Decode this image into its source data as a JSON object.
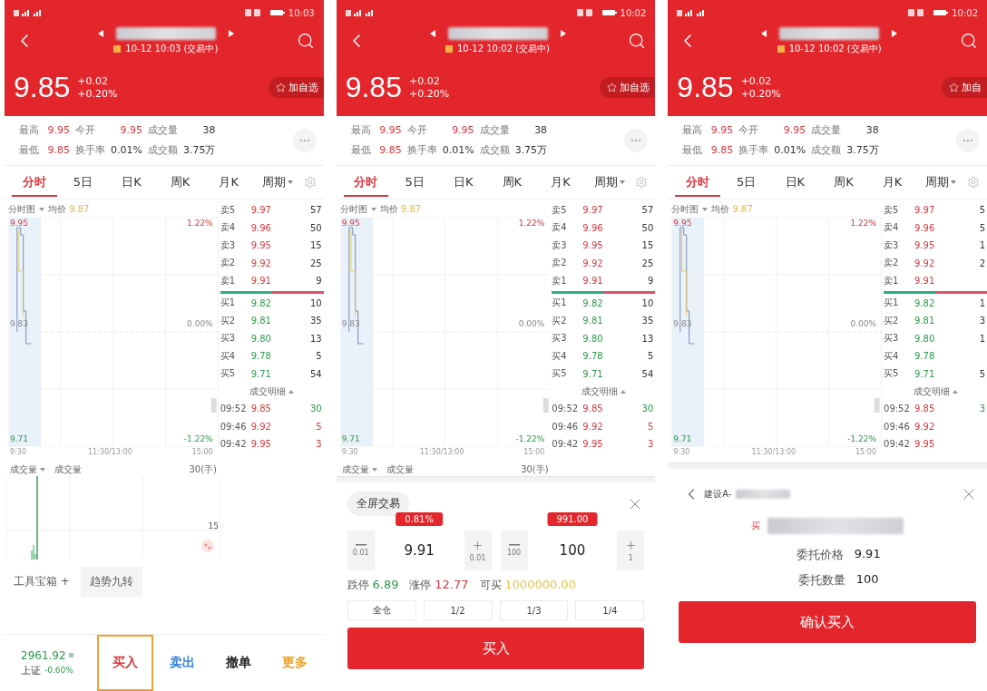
{
  "screens": [
    {
      "status_time": "10:03",
      "date_line": "10-12 10:03 (交易中)",
      "price": "9.85",
      "change": "+0.02",
      "change_pct": "+0.20%",
      "watch_label": "加自选",
      "stats": [
        {
          "label": "最高",
          "value": "9.95",
          "kind": "price"
        },
        {
          "label": "今开",
          "value": "9.95",
          "kind": "price"
        },
        {
          "label": "成交量",
          "value": "38",
          "kind": "plain"
        },
        {
          "label": "最低",
          "value": "9.85",
          "kind": "price"
        },
        {
          "label": "换手率",
          "value": "0.01%",
          "kind": "plain"
        },
        {
          "label": "成交额",
          "value": "3.75万",
          "kind": "plain"
        }
      ],
      "tabs": [
        {
          "label": "分时",
          "selected": true,
          "dropdown": false
        },
        {
          "label": "5日",
          "selected": false,
          "dropdown": false
        },
        {
          "label": "日K",
          "selected": false,
          "dropdown": false
        },
        {
          "label": "周K",
          "selected": false,
          "dropdown": false
        },
        {
          "label": "月K",
          "selected": false,
          "dropdown": false
        },
        {
          "label": "周期",
          "selected": false,
          "dropdown": true
        }
      ],
      "chart": {
        "title": "分时图",
        "avg_label": "均价",
        "avg_value": "9.87",
        "high": "9.95",
        "mid": "9.83",
        "low": "9.71",
        "high_pct": "1.22%",
        "mid_pct": "0.00%",
        "low_pct": "-1.22%",
        "t_start": "9:30",
        "t_mid": "11:30/13:00",
        "t_end": "15:00"
      },
      "asks": [
        {
          "label": "卖5",
          "price": "9.97",
          "qty": "57"
        },
        {
          "label": "卖4",
          "price": "9.96",
          "qty": "50"
        },
        {
          "label": "卖3",
          "price": "9.95",
          "qty": "15"
        },
        {
          "label": "卖2",
          "price": "9.92",
          "qty": "25"
        },
        {
          "label": "卖1",
          "price": "9.91",
          "qty": "9"
        }
      ],
      "bids": [
        {
          "label": "买1",
          "price": "9.82",
          "qty": "10"
        },
        {
          "label": "买2",
          "price": "9.81",
          "qty": "35"
        },
        {
          "label": "买3",
          "price": "9.80",
          "qty": "13"
        },
        {
          "label": "买4",
          "price": "9.78",
          "qty": "5"
        },
        {
          "label": "买5",
          "price": "9.71",
          "qty": "54"
        }
      ],
      "trades_title": "成交明细",
      "trades": [
        {
          "time": "09:52",
          "price": "9.85",
          "qty": "30",
          "color": "#2b9a4b"
        },
        {
          "time": "09:46",
          "price": "9.92",
          "qty": "5",
          "color": "#d9363e"
        },
        {
          "time": "09:42",
          "price": "9.95",
          "qty": "3",
          "color": "#d9363e"
        }
      ],
      "volume": {
        "title": "成交量",
        "label": "成交量",
        "max": "30(手)",
        "mid": "15"
      },
      "panel": {
        "kind": "toolbar",
        "tools_label": "工具宝箱 +",
        "tool_chip": "趋势九转",
        "index_value": "2961.92",
        "index_name": "上证",
        "index_change": "-0.60%",
        "actions": [
          {
            "label": "买入",
            "selected": true,
            "kind": "buy"
          },
          {
            "label": "卖出",
            "selected": false,
            "kind": "sell"
          },
          {
            "label": "撤单",
            "selected": false,
            "kind": "cancel"
          },
          {
            "label": "更多",
            "selected": false,
            "kind": "more"
          }
        ]
      }
    },
    {
      "status_time": "10:02",
      "date_line": "10-12 10:02 (交易中)",
      "price": "9.85",
      "change": "+0.02",
      "change_pct": "+0.20%",
      "watch_label": "加自选",
      "stats": [
        {
          "label": "最高",
          "value": "9.95",
          "kind": "price"
        },
        {
          "label": "今开",
          "value": "9.95",
          "kind": "price"
        },
        {
          "label": "成交量",
          "value": "38",
          "kind": "plain"
        },
        {
          "label": "最低",
          "value": "9.85",
          "kind": "price"
        },
        {
          "label": "换手率",
          "value": "0.01%",
          "kind": "plain"
        },
        {
          "label": "成交额",
          "value": "3.75万",
          "kind": "plain"
        }
      ],
      "tabs": [
        {
          "label": "分时",
          "selected": true,
          "dropdown": false
        },
        {
          "label": "5日",
          "selected": false,
          "dropdown": false
        },
        {
          "label": "日K",
          "selected": false,
          "dropdown": false
        },
        {
          "label": "周K",
          "selected": false,
          "dropdown": false
        },
        {
          "label": "月K",
          "selected": false,
          "dropdown": false
        },
        {
          "label": "周期",
          "selected": false,
          "dropdown": true
        }
      ],
      "chart": {
        "title": "分时图",
        "avg_label": "均价",
        "avg_value": "9.87",
        "high": "9.95",
        "mid": "9.83",
        "low": "9.71",
        "high_pct": "1.22%",
        "mid_pct": "0.00%",
        "low_pct": "-1.22%",
        "t_start": "9:30",
        "t_mid": "11:30/13:00",
        "t_end": "15:00"
      },
      "asks": [
        {
          "label": "卖5",
          "price": "9.97",
          "qty": "57"
        },
        {
          "label": "卖4",
          "price": "9.96",
          "qty": "50"
        },
        {
          "label": "卖3",
          "price": "9.95",
          "qty": "15"
        },
        {
          "label": "卖2",
          "price": "9.92",
          "qty": "25"
        },
        {
          "label": "卖1",
          "price": "9.91",
          "qty": "9"
        }
      ],
      "bids": [
        {
          "label": "买1",
          "price": "9.82",
          "qty": "10"
        },
        {
          "label": "买2",
          "price": "9.81",
          "qty": "35"
        },
        {
          "label": "买3",
          "price": "9.80",
          "qty": "13"
        },
        {
          "label": "买4",
          "price": "9.78",
          "qty": "5"
        },
        {
          "label": "买5",
          "price": "9.71",
          "qty": "54"
        }
      ],
      "trades_title": "成交明细",
      "trades": [
        {
          "time": "09:52",
          "price": "9.85",
          "qty": "30",
          "color": "#2b9a4b"
        },
        {
          "time": "09:46",
          "price": "9.92",
          "qty": "5",
          "color": "#d9363e"
        },
        {
          "time": "09:42",
          "price": "9.95",
          "qty": "3",
          "color": "#d9363e"
        }
      ],
      "volume": {
        "title": "成交量",
        "label": "成交量",
        "max": "30(手)"
      },
      "panel": {
        "kind": "order",
        "mode_chip": "全屏交易",
        "price": {
          "value": "9.91",
          "tip": "0.81%",
          "minus_step": "0.01",
          "plus_step": "0.01"
        },
        "qty": {
          "value": "100",
          "tip": "991.00",
          "minus_step": "100",
          "plus_step": "1"
        },
        "limits": [
          {
            "label": "跌停",
            "value": "6.89",
            "kind": "down"
          },
          {
            "label": "涨停",
            "value": "12.77",
            "kind": "up"
          },
          {
            "label": "可买",
            "value": "1000000.00",
            "kind": "cash"
          }
        ],
        "fractions": [
          "全仓",
          "1/2",
          "1/3",
          "1/4"
        ],
        "submit": "买入"
      }
    },
    {
      "status_time": "10:02",
      "date_line": "10-12 10:02 (交易中)",
      "price": "9.85",
      "change": "+0.02",
      "change_pct": "+0.20%",
      "watch_label": "加自",
      "stats": [
        {
          "label": "最高",
          "value": "9.95",
          "kind": "price"
        },
        {
          "label": "今开",
          "value": "9.95",
          "kind": "price"
        },
        {
          "label": "成交量",
          "value": "38",
          "kind": "plain"
        },
        {
          "label": "最低",
          "value": "9.85",
          "kind": "price"
        },
        {
          "label": "换手率",
          "value": "0.01%",
          "kind": "plain"
        },
        {
          "label": "成交额",
          "value": "3.75万",
          "kind": "plain"
        }
      ],
      "tabs": [
        {
          "label": "分时",
          "selected": true,
          "dropdown": false
        },
        {
          "label": "5日",
          "selected": false,
          "dropdown": false
        },
        {
          "label": "日K",
          "selected": false,
          "dropdown": false
        },
        {
          "label": "周K",
          "selected": false,
          "dropdown": false
        },
        {
          "label": "月K",
          "selected": false,
          "dropdown": false
        },
        {
          "label": "周期",
          "selected": false,
          "dropdown": true
        }
      ],
      "chart": {
        "title": "分时图",
        "avg_label": "均价",
        "avg_value": "9.87",
        "high": "9.95",
        "mid": "9.83",
        "low": "9.71",
        "high_pct": "1.22%",
        "mid_pct": "0.00%",
        "low_pct": "-1.22%",
        "t_start": "9:30",
        "t_mid": "11:30/13:00",
        "t_end": "15:00"
      },
      "asks": [
        {
          "label": "卖5",
          "price": "9.97",
          "qty": "5"
        },
        {
          "label": "卖4",
          "price": "9.96",
          "qty": "5"
        },
        {
          "label": "卖3",
          "price": "9.95",
          "qty": "1"
        },
        {
          "label": "卖2",
          "price": "9.92",
          "qty": "2"
        },
        {
          "label": "卖1",
          "price": "9.91"
        }
      ],
      "bids": [
        {
          "label": "买1",
          "price": "9.82",
          "qty": "1"
        },
        {
          "label": "买2",
          "price": "9.81",
          "qty": "3"
        },
        {
          "label": "买3",
          "price": "9.80",
          "qty": "1"
        },
        {
          "label": "买4",
          "price": "9.78"
        },
        {
          "label": "买5",
          "price": "9.71",
          "qty": "5"
        }
      ],
      "trades_title": "成交明细",
      "trades": [
        {
          "time": "09:52",
          "price": "9.85",
          "qty": "3",
          "color": "#2b9a4b"
        },
        {
          "time": "09:46",
          "price": "9.92"
        },
        {
          "time": "09:42",
          "price": "9.95"
        }
      ],
      "panel": {
        "kind": "confirm",
        "title": "建设A-",
        "side_mark": "买",
        "rows": [
          {
            "label": "委托价格",
            "value": "9.91"
          },
          {
            "label": "委托数量",
            "value": "100"
          }
        ],
        "submit": "确认买入"
      }
    }
  ]
}
